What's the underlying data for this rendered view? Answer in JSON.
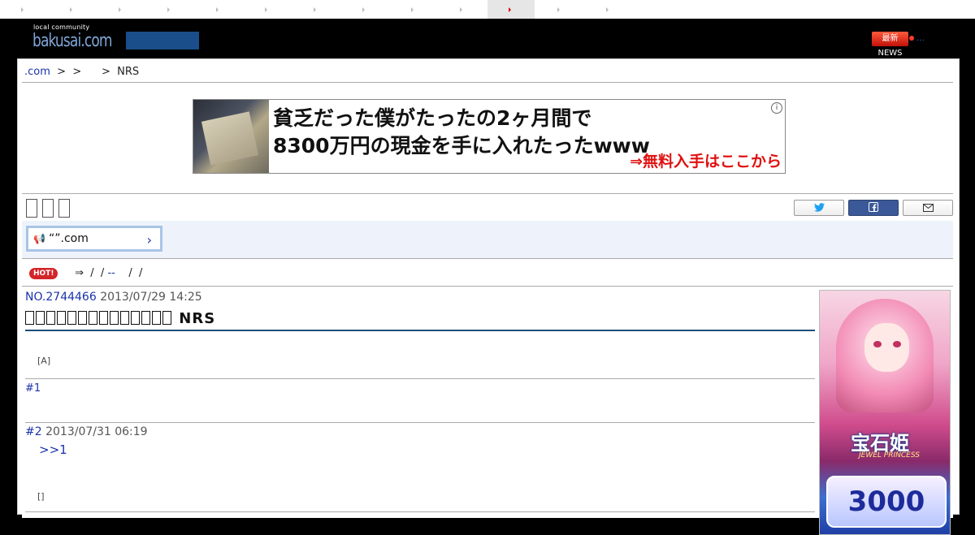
{
  "top_tabs": [
    {
      "name": "tab-1",
      "active": false
    },
    {
      "name": "tab-2",
      "active": false
    },
    {
      "name": "tab-3",
      "active": false
    },
    {
      "name": "tab-4",
      "active": false
    },
    {
      "name": "tab-5",
      "active": false
    },
    {
      "name": "tab-6",
      "active": false
    },
    {
      "name": "tab-7",
      "active": false
    },
    {
      "name": "tab-8",
      "active": false
    },
    {
      "name": "tab-9",
      "active": false
    },
    {
      "name": "tab-10",
      "active": false
    },
    {
      "name": "tab-11",
      "active": true
    },
    {
      "name": "tab-12",
      "active": false
    },
    {
      "name": "tab-13",
      "active": false
    }
  ],
  "header": {
    "logo_small": "local community",
    "logo_main": "bakusai.com",
    "news_badge": "最新NEWS"
  },
  "breadcrumb": {
    "site": ".com",
    "rest": "  >  >      >  NRS"
  },
  "ad": {
    "line1": "貧乏だった僕がたったの2ヶ月間で",
    "line2": "8300万円の現金を手に入れたったwww",
    "cta": "⇒無料入手はここから",
    "info_icon": "i"
  },
  "share": {
    "twitter_icon": "twitter-icon",
    "facebook_icon": "facebook-icon",
    "mail_icon": "mail-icon"
  },
  "notice": {
    "text": "“”.com",
    "chevron": "›"
  },
  "hot_row": {
    "badge": "HOT!",
    "arrow": "⇒",
    "sep1": "  /  / ",
    "link": "--",
    "sep2": "    /  /"
  },
  "thread": {
    "number": "NO.2744466",
    "date": "2013/07/29 14:25",
    "title_suffix": "NRS",
    "post1_tag": "[A]",
    "reply1_num": "#1",
    "reply2_num": "#2",
    "reply2_date": "2013/07/31 06:19",
    "reply2_anchor": ">>1",
    "reply2_tag": "[]"
  },
  "side_ad": {
    "title": "宝石姫",
    "subtitle": "JEWEL PRINCESS",
    "number": "3000"
  },
  "colors": {
    "link": "#1a33aa",
    "header_bg": "#000000",
    "accent_rule": "#1a4e7a",
    "hot_badge": "#d4242a",
    "ad_cta": "#e01010"
  }
}
